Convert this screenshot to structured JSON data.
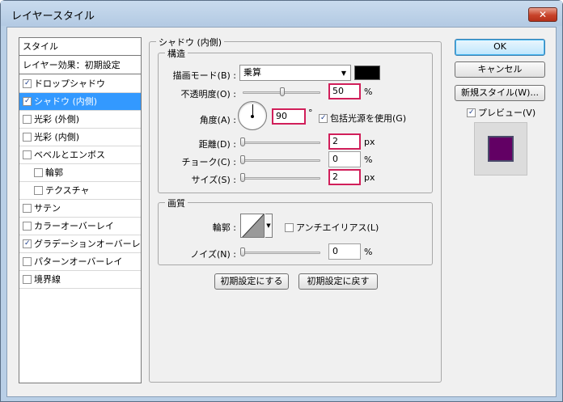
{
  "window": {
    "title": "レイヤースタイル",
    "close_label": "✕"
  },
  "left_panel": {
    "header": "スタイル",
    "blend_options": "レイヤー効果：初期設定",
    "items": [
      {
        "label": "ドロップシャドウ",
        "checked": true,
        "selected": false,
        "indent": false
      },
      {
        "label": "シャドウ (内側)",
        "checked": true,
        "selected": true,
        "indent": false
      },
      {
        "label": "光彩 (外側)",
        "checked": false,
        "selected": false,
        "indent": false
      },
      {
        "label": "光彩 (内側)",
        "checked": false,
        "selected": false,
        "indent": false
      },
      {
        "label": "ベベルとエンボス",
        "checked": false,
        "selected": false,
        "indent": false
      },
      {
        "label": "輪郭",
        "checked": false,
        "selected": false,
        "indent": true
      },
      {
        "label": "テクスチャ",
        "checked": false,
        "selected": false,
        "indent": true
      },
      {
        "label": "サテン",
        "checked": false,
        "selected": false,
        "indent": false
      },
      {
        "label": "カラーオーバーレイ",
        "checked": false,
        "selected": false,
        "indent": false
      },
      {
        "label": "グラデーションオーバーレイ",
        "checked": true,
        "selected": false,
        "indent": false
      },
      {
        "label": "パターンオーバーレイ",
        "checked": false,
        "selected": false,
        "indent": false
      },
      {
        "label": "境界線",
        "checked": false,
        "selected": false,
        "indent": false
      }
    ]
  },
  "inner_shadow": {
    "title": "シャドウ (内側)",
    "structure": {
      "title": "構造",
      "blend_mode_label": "描画モード(B) :",
      "blend_mode_value": "乗算",
      "shadow_color": "#000000",
      "opacity_label": "不透明度(O) :",
      "opacity_value": "50",
      "opacity_unit": "%",
      "angle_label": "角度(A) :",
      "angle_value": "90",
      "angle_unit": "°",
      "global_light_label": "包括光源を使用(G)",
      "global_light_checked": true,
      "distance_label": "距離(D) :",
      "distance_value": "2",
      "distance_unit": "px",
      "choke_label": "チョーク(C) :",
      "choke_value": "0",
      "choke_unit": "%",
      "size_label": "サイズ(S) :",
      "size_value": "2",
      "size_unit": "px"
    },
    "quality": {
      "title": "画質",
      "contour_label": "輪郭 :",
      "antialias_label": "アンチエイリアス(L)",
      "antialias_checked": false,
      "noise_label": "ノイズ(N) :",
      "noise_value": "0",
      "noise_unit": "%"
    },
    "make_default_label": "初期設定にする",
    "reset_default_label": "初期設定に戻す"
  },
  "buttons": {
    "ok": "OK",
    "cancel": "キャンセル",
    "new_style": "新規スタイル(W)...",
    "preview_label": "プレビュー(V)",
    "preview_checked": true,
    "preview_color": "#620064"
  },
  "highlight_color": "#d11f5a",
  "selection_color": "#3399ff"
}
